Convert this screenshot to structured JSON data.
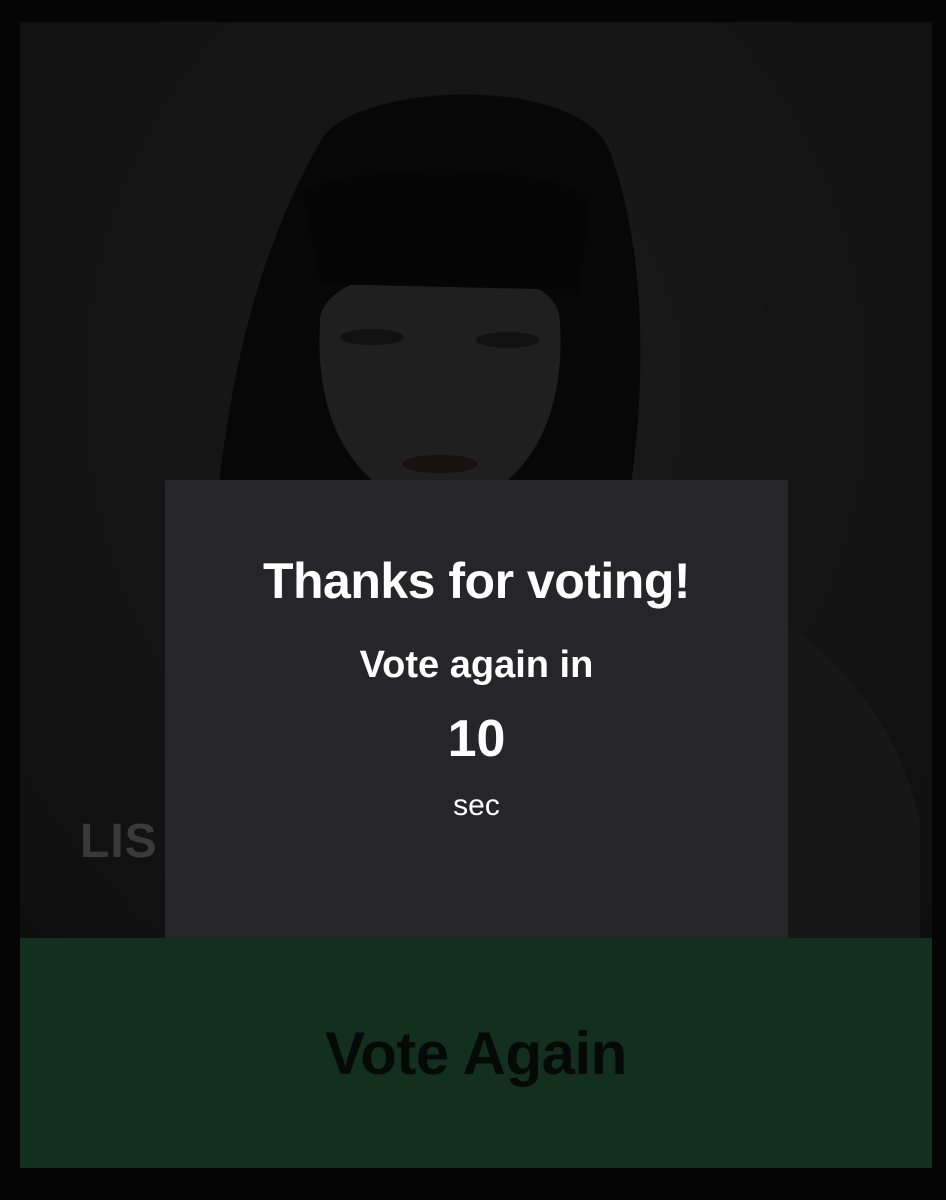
{
  "card": {
    "artist_name": "LIS"
  },
  "modal": {
    "title": "Thanks for voting!",
    "subtitle": "Vote again in",
    "countdown": "10",
    "unit": "sec"
  },
  "vote_bar": {
    "label": "Vote Again"
  },
  "colors": {
    "page_background": "#050505",
    "card_background": "#131313",
    "modal_background": "#26252a",
    "vote_bar_background": "#12301d",
    "vote_bar_text": "#060a07",
    "artist_name_text": "#3a3a3a"
  }
}
